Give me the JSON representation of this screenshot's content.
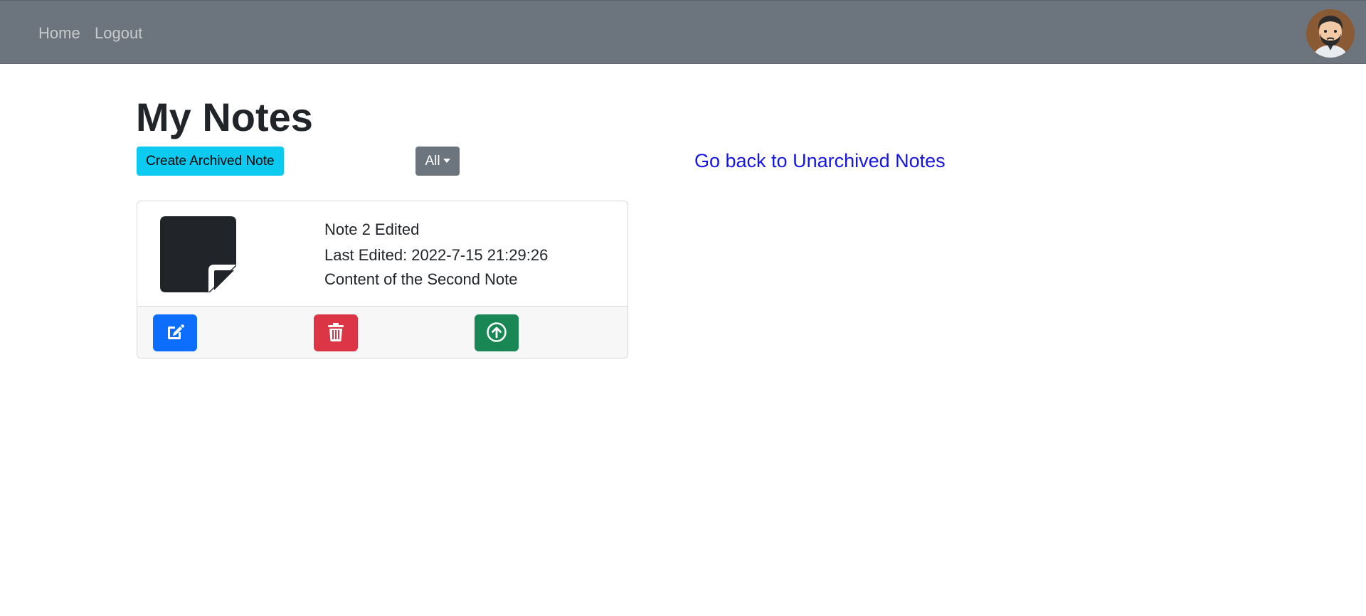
{
  "nav": {
    "home_label": "Home",
    "logout_label": "Logout",
    "avatar_icon": "user-avatar-icon"
  },
  "page": {
    "title": "My Notes",
    "create_button_label": "Create Archived Note",
    "filter_selected": "All",
    "back_link_label": "Go back to Unarchived Notes"
  },
  "notes": [
    {
      "title": "Note 2 Edited",
      "last_edited": "Last Edited: 2022-7-15 21:29:26",
      "content": "Content of the Second Note",
      "icon": "sticky-note-icon",
      "actions": {
        "edit_icon": "edit-icon",
        "delete_icon": "trash-icon",
        "unarchive_icon": "arrow-up-circle-icon"
      }
    }
  ],
  "colors": {
    "navbar": "#6c757d",
    "create_button": "#0dcaf0",
    "filter_button": "#6c757d",
    "link": "#1515e8",
    "edit_button": "#0d6efd",
    "delete_button": "#dc3545",
    "unarchive_button": "#198754"
  }
}
